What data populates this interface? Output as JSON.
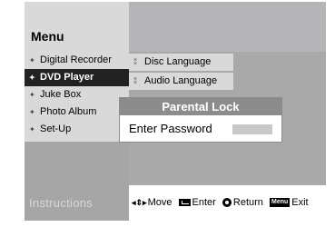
{
  "menu": {
    "title": "Menu"
  },
  "left_menu": {
    "items": [
      {
        "label": "Digital Recorder",
        "icon": "disc-icon",
        "active": false
      },
      {
        "label": "DVD Player",
        "icon": "disc-icon",
        "active": true
      },
      {
        "label": "Juke Box",
        "icon": "disc-icon",
        "active": false
      },
      {
        "label": "Photo Album",
        "icon": "disc-icon",
        "active": false
      },
      {
        "label": "Set-Up",
        "icon": "disc-icon",
        "active": false
      }
    ]
  },
  "sub_menu": {
    "items": [
      {
        "label": "Disc Language",
        "icon": "arrow-icon"
      },
      {
        "label": "Audio Language",
        "icon": "arrow-icon"
      }
    ]
  },
  "dialog": {
    "title": "Parental Lock",
    "label": "Enter Password",
    "password_value": ""
  },
  "instructions": {
    "label": "Instructions",
    "move": "Move",
    "enter": "Enter",
    "return": "Return",
    "menu_key": "Menu",
    "exit": "Exit"
  }
}
